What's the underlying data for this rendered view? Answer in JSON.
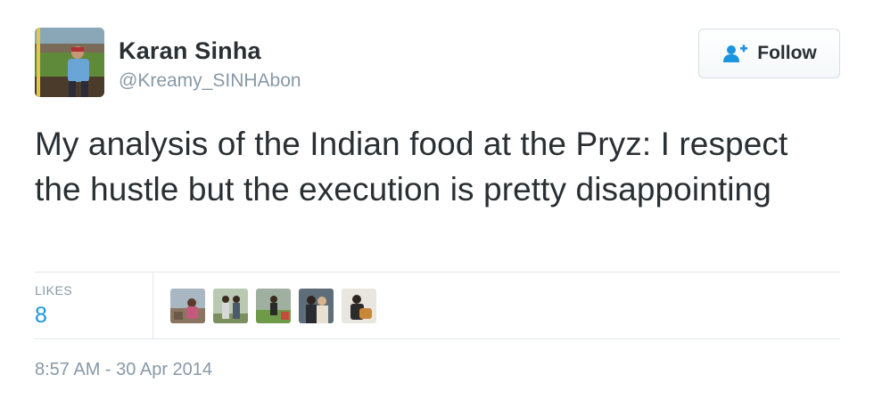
{
  "author": {
    "name": "Karan Sinha",
    "handle": "@Kreamy_SINHAbon",
    "avatar_icon": "profile-photo-baseball-stadium"
  },
  "follow_button": {
    "label": "Follow",
    "icon": "add-user-icon",
    "accent": "#1b95e0"
  },
  "tweet": {
    "text": "My analysis of the Indian food at the Pryz: I respect the hustle but the execution is pretty disappointing"
  },
  "stats": {
    "likes_label": "LIKES",
    "likes_count": "8",
    "likers": [
      {
        "icon": "liker-avatar-1"
      },
      {
        "icon": "liker-avatar-2"
      },
      {
        "icon": "liker-avatar-3"
      },
      {
        "icon": "liker-avatar-4"
      },
      {
        "icon": "liker-avatar-5"
      }
    ]
  },
  "timestamp": "8:57 AM - 30 Apr 2014",
  "colors": {
    "text": "#292f33",
    "muted": "#8899a6",
    "link": "#1b95e0",
    "divider": "#e1e8ed"
  }
}
